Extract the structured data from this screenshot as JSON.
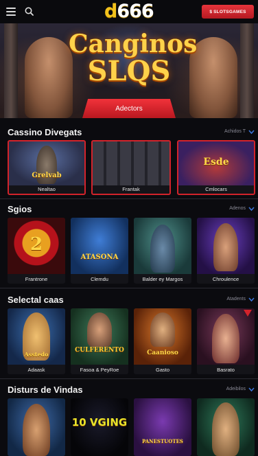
{
  "header": {
    "logo_accent": "d",
    "logo_rest": "666",
    "cta_label": "$ SLOTSGAMES"
  },
  "hero": {
    "title_line1": "Canginos",
    "title_line2": "SLQS",
    "button_label": "Adectors"
  },
  "sections": [
    {
      "title": "Cassino Divegats",
      "more": "Achidos T",
      "tiles": [
        {
          "caption": "Nealtao",
          "art": "Grelvab"
        },
        {
          "caption": "Frantak",
          "art": ""
        },
        {
          "caption": "Cmlocars",
          "art": "Esde"
        }
      ]
    },
    {
      "title": "Sgios",
      "more": "Adenos",
      "tiles": [
        {
          "caption": "Frantrone",
          "art": "2"
        },
        {
          "caption": "Clemdu",
          "art": "ATASONA"
        },
        {
          "caption": "Balder ey Margos",
          "art": ""
        },
        {
          "caption": "Chroulence",
          "art": ""
        }
      ]
    },
    {
      "title": "Selectal caas",
      "more": "Atadents",
      "tiles": [
        {
          "caption": "Adaask",
          "art": "Asstedo"
        },
        {
          "caption": "Fasoa & PeyRoe",
          "art": "CULFERENTO"
        },
        {
          "caption": "Gasto",
          "art": "Caanioso"
        },
        {
          "caption": "Basrato",
          "art": ""
        }
      ]
    },
    {
      "title": "Disturs de Vindas",
      "more": "Adeibilos",
      "tiles": [
        {
          "caption": "",
          "art": ""
        },
        {
          "caption": "",
          "art": "10 VGING"
        },
        {
          "caption": "",
          "art": "PANESTUOTES"
        },
        {
          "caption": "",
          "art": ""
        }
      ]
    }
  ],
  "colors": {
    "accent": "#d3232b",
    "logo_gold": "#f3c21c",
    "background": "#0b0b0f"
  }
}
